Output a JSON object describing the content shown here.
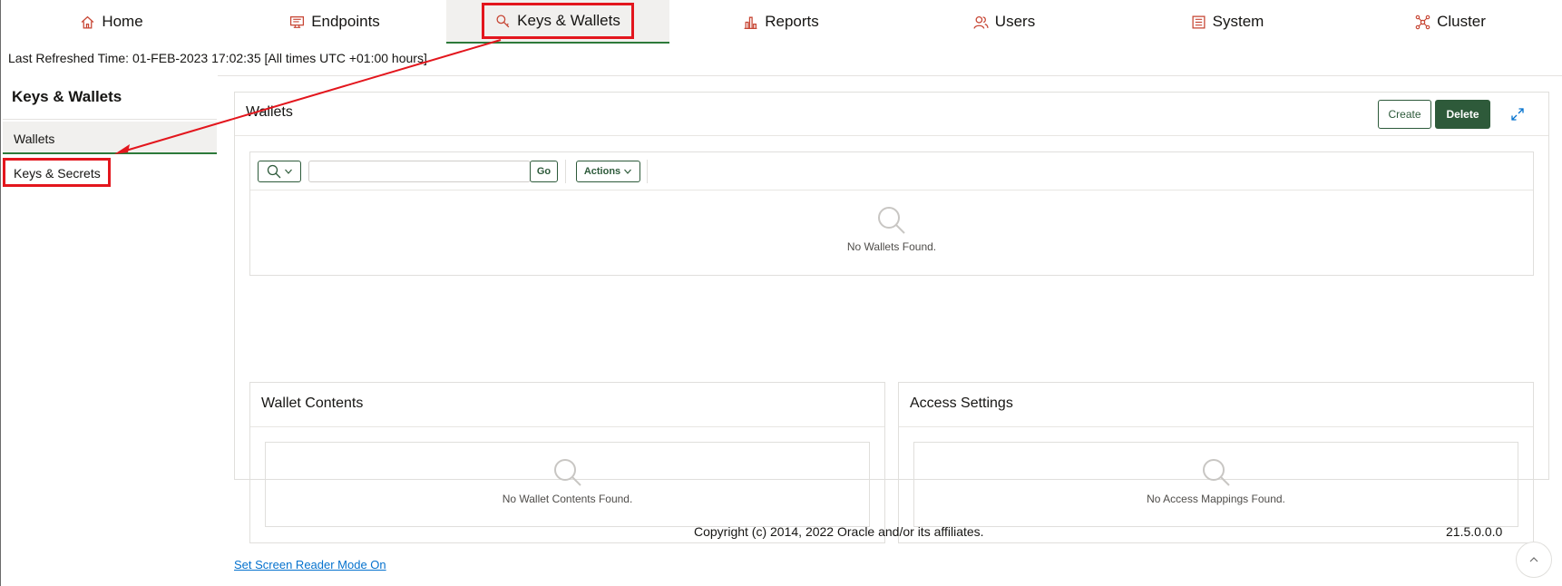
{
  "nav": {
    "tabs": [
      {
        "label": "Home",
        "icon": "home-icon"
      },
      {
        "label": "Endpoints",
        "icon": "monitor-icon"
      },
      {
        "label": "Keys & Wallets",
        "icon": "key-icon",
        "active": true
      },
      {
        "label": "Reports",
        "icon": "bar-chart-icon"
      },
      {
        "label": "Users",
        "icon": "users-icon"
      },
      {
        "label": "System",
        "icon": "system-icon"
      },
      {
        "label": "Cluster",
        "icon": "cluster-icon"
      }
    ]
  },
  "refresh_text": "Last Refreshed Time: 01-FEB-2023 17:02:35 [All times UTC +01:00 hours]",
  "sidebar": {
    "title": "Keys & Wallets",
    "items": [
      {
        "label": "Wallets",
        "selected": true
      },
      {
        "label": "Keys & Secrets",
        "selected": false
      }
    ]
  },
  "wallets": {
    "title": "Wallets",
    "create_label": "Create",
    "delete_label": "Delete",
    "go_label": "Go",
    "actions_label": "Actions",
    "search_placeholder": "",
    "empty_text": "No Wallets Found."
  },
  "wallet_contents": {
    "title": "Wallet Contents",
    "empty_text": "No Wallet Contents Found."
  },
  "access_settings": {
    "title": "Access Settings",
    "empty_text": "No Access Mappings Found."
  },
  "footer": {
    "copyright": "Copyright (c) 2014, 2022 Oracle and/or its affiliates.",
    "version": "21.5.0.0.0",
    "screen_reader_link": "Set Screen Reader Mode On"
  },
  "colors": {
    "accent_green": "#2e5a3a",
    "nav_icon_red": "#c74634",
    "highlight_red": "#e3161d",
    "link_blue": "#0572ce"
  }
}
